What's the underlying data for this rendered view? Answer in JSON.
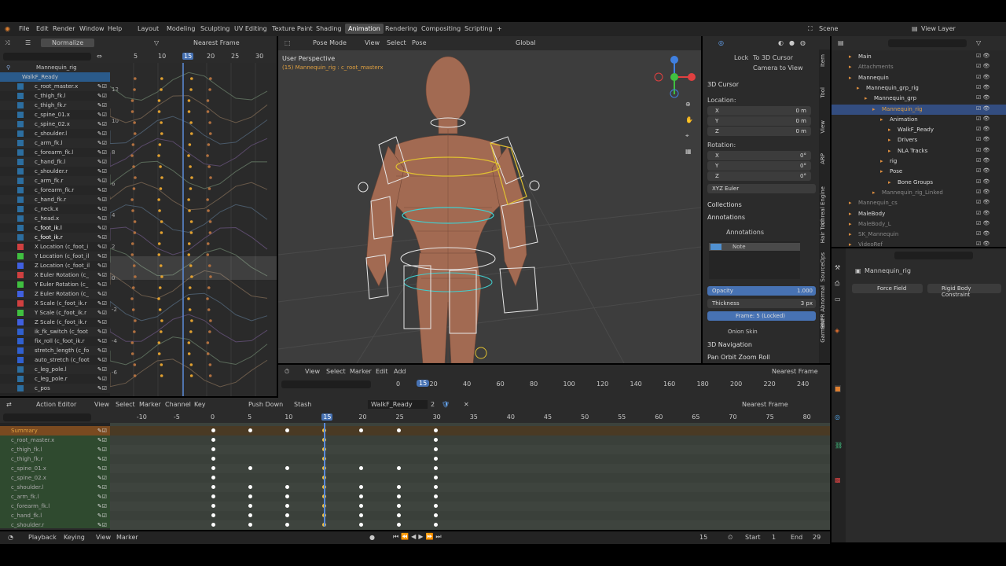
{
  "menu": [
    "File",
    "Edit",
    "Render",
    "Window",
    "Help"
  ],
  "workspaces": [
    "Layout",
    "Modeling",
    "Sculpting",
    "UV Editing",
    "Texture Paint",
    "Shading",
    "Animation",
    "Rendering",
    "Compositing",
    "Scripting"
  ],
  "active_workspace": "Animation",
  "scene": "Scene",
  "view_layer": "View Layer",
  "graph": {
    "normalize": "Normalize",
    "snap": "Nearest Frame",
    "ticks": [
      "5",
      "10",
      "15",
      "20",
      "25",
      "30"
    ],
    "current": "15",
    "yticks": [
      "12",
      "10",
      "8",
      "6",
      "4",
      "2",
      "0",
      "-2",
      "-4",
      "-6"
    ],
    "root": "Mannequin_rig",
    "action": "WalkF_Ready",
    "channels": [
      "c_root_master.x",
      "c_thigh_fk.l",
      "c_thigh_fk.r",
      "c_spine_01.x",
      "c_spine_02.x",
      "c_shoulder.l",
      "c_arm_fk.l",
      "c_forearm_fk.l",
      "c_hand_fk.l",
      "c_shoulder.r",
      "c_arm_fk.r",
      "c_forearm_fk.r",
      "c_hand_fk.r",
      "c_neck.x",
      "c_head.x",
      "c_foot_ik.l",
      "c_foot_ik.r",
      "X Location (c_foot_i",
      "Y Location (c_foot_il",
      "Z Location (c_foot_il",
      "X Euler Rotation (c_",
      "Y Euler Rotation (c_",
      "Z Euler Rotation (c_",
      "X Scale (c_foot_ik.r",
      "Y Scale (c_foot_ik.r",
      "Z Scale (c_foot_ik.r",
      "ik_fk_switch (c_foot",
      "fix_roll (c_foot_ik.r",
      "stretch_length (c_fo",
      "auto_stretch (c_foot",
      "c_leg_pole.l",
      "c_leg_pole.r",
      "c_pos"
    ],
    "channel_colors": [
      "#2c6ea0",
      "#2c6ea0",
      "#2c6ea0",
      "#2c6ea0",
      "#2c6ea0",
      "#2c6ea0",
      "#2c6ea0",
      "#2c6ea0",
      "#2c6ea0",
      "#2c6ea0",
      "#2c6ea0",
      "#2c6ea0",
      "#2c6ea0",
      "#2c6ea0",
      "#2c6ea0",
      "#2c6ea0",
      "#2c6ea0",
      "#d04040",
      "#40c040",
      "#4060e0",
      "#d04040",
      "#40c040",
      "#4060e0",
      "#d04040",
      "#40c040",
      "#4060e0",
      "#3060d0",
      "#3060d0",
      "#3060d0",
      "#3060d0",
      "#2c6ea0",
      "#2c6ea0",
      "#2c6ea0"
    ]
  },
  "viewport": {
    "mode": "Pose Mode",
    "menus": [
      "View",
      "Select",
      "Pose"
    ],
    "orientation": "Global",
    "title": "User Perspective",
    "subtitle": "(15) Mannequin_rig : c_root_masterx"
  },
  "sidebar": {
    "lock": "Lock",
    "to_cursor": "To 3D Cursor",
    "camera_to_view": "Camera to View",
    "cursor": "3D Cursor",
    "location": "Location:",
    "x": "X",
    "y": "Y",
    "z": "Z",
    "loc_val": "0 m",
    "rotation": "Rotation:",
    "rot_val": "0°",
    "euler": "XYZ Euler",
    "collections": "Collections",
    "annotations": "Annotations",
    "ann_layer": "Annotations",
    "note": "Note",
    "opacity_label": "Opacity",
    "opacity": "1.000",
    "thickness_label": "Thickness",
    "thickness": "3 px",
    "frame_locked": "Frame: 5 (Locked)",
    "onion": "Onion Skin",
    "nav": "3D Navigation",
    "orbit": "Pan Orbit Zoom Roll"
  },
  "sidetabs": [
    "Item",
    "Tool",
    "View",
    "ARP",
    "Unreal Engine",
    "Hair Tool",
    "SourceOps",
    "BNPR Abnormal",
    "Garment"
  ],
  "outliner": [
    "Main",
    "Attachments",
    "Mannequin",
    "Mannequin_grp_rig",
    "Mannequin_grp",
    "Mannequin_rig",
    "Animation",
    "WalkF_Ready",
    "Drivers",
    "NLA Tracks",
    "rig",
    "Pose",
    "Bone Groups",
    "Mannequin_rig_Linked",
    "Mannequin_cs",
    "MaleBody",
    "MaleBody_L",
    "SK_Mannequin",
    "VideoRef"
  ],
  "props": {
    "object": "Mannequin_rig",
    "force": "Force Field",
    "rigid": "Rigid Body Constraint"
  },
  "timeline": {
    "ticks": [
      "0",
      "20",
      "40",
      "60",
      "80",
      "100",
      "120",
      "140",
      "160",
      "180",
      "200",
      "220",
      "240"
    ],
    "current": "15",
    "snap": "Nearest Frame",
    "menus": [
      "View",
      "Select",
      "Marker",
      "Edit",
      "Add"
    ]
  },
  "action": {
    "mode": "Action Editor",
    "menus": [
      "View",
      "Select",
      "Marker",
      "Channel",
      "Key"
    ],
    "push": "Push Down",
    "stash": "Stash",
    "name": "WalkF_Ready",
    "users": "2",
    "snap": "Nearest Frame",
    "ticks": [
      "-10",
      "-5",
      "0",
      "5",
      "10",
      "15",
      "20",
      "25",
      "30",
      "35",
      "40",
      "45",
      "50",
      "55",
      "60",
      "65",
      "70",
      "75",
      "80"
    ],
    "current": "15",
    "channels": [
      "Summary",
      "c_root_master.x",
      "c_thigh_fk.l",
      "c_thigh_fk.r",
      "c_spine_01.x",
      "c_spine_02.x",
      "c_shoulder.l",
      "c_arm_fk.l",
      "c_forearm_fk.l",
      "c_hand_fk.l",
      "c_shoulder.r"
    ],
    "keys": [
      [
        0,
        5,
        10,
        15,
        20,
        25,
        30
      ],
      [
        0,
        15,
        30
      ],
      [
        0,
        15,
        30
      ],
      [
        0,
        15,
        30
      ],
      [
        0,
        5,
        10,
        15,
        20,
        25,
        30
      ],
      [
        0,
        15,
        30
      ],
      [
        0,
        5,
        10,
        15,
        20,
        25,
        30
      ],
      [
        0,
        5,
        10,
        15,
        20,
        25,
        30
      ],
      [
        0,
        5,
        10,
        15,
        20,
        25,
        30
      ],
      [
        0,
        5,
        10,
        15,
        20,
        25,
        30
      ],
      [
        0,
        5,
        10,
        15,
        20,
        25,
        30
      ]
    ]
  },
  "status": {
    "playback": "Playback",
    "keying": "Keying",
    "view": "View",
    "marker": "Marker",
    "frame": "15",
    "start_label": "Start",
    "start": "1",
    "end_label": "End",
    "end": "29"
  }
}
